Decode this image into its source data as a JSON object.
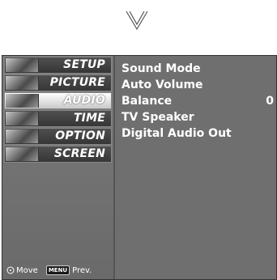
{
  "sidebar": {
    "items": [
      {
        "label": "SETUP",
        "selected": false
      },
      {
        "label": "PICTURE",
        "selected": false
      },
      {
        "label": "AUDIO",
        "selected": true
      },
      {
        "label": "TIME",
        "selected": false
      },
      {
        "label": "OPTION",
        "selected": false
      },
      {
        "label": "SCREEN",
        "selected": false
      }
    ]
  },
  "footer": {
    "move_label": "Move",
    "menu_button": "MENU",
    "prev_label": "Prev."
  },
  "content": {
    "options": [
      {
        "label": "Sound Mode",
        "value": ""
      },
      {
        "label": "Auto Volume",
        "value": ""
      },
      {
        "label": "Balance",
        "value": "0"
      },
      {
        "label": "TV Speaker",
        "value": ""
      },
      {
        "label": "Digital Audio Out",
        "value": ""
      }
    ]
  },
  "icons": {
    "top": "chevron-down-icon",
    "move": "dpad-icon"
  }
}
